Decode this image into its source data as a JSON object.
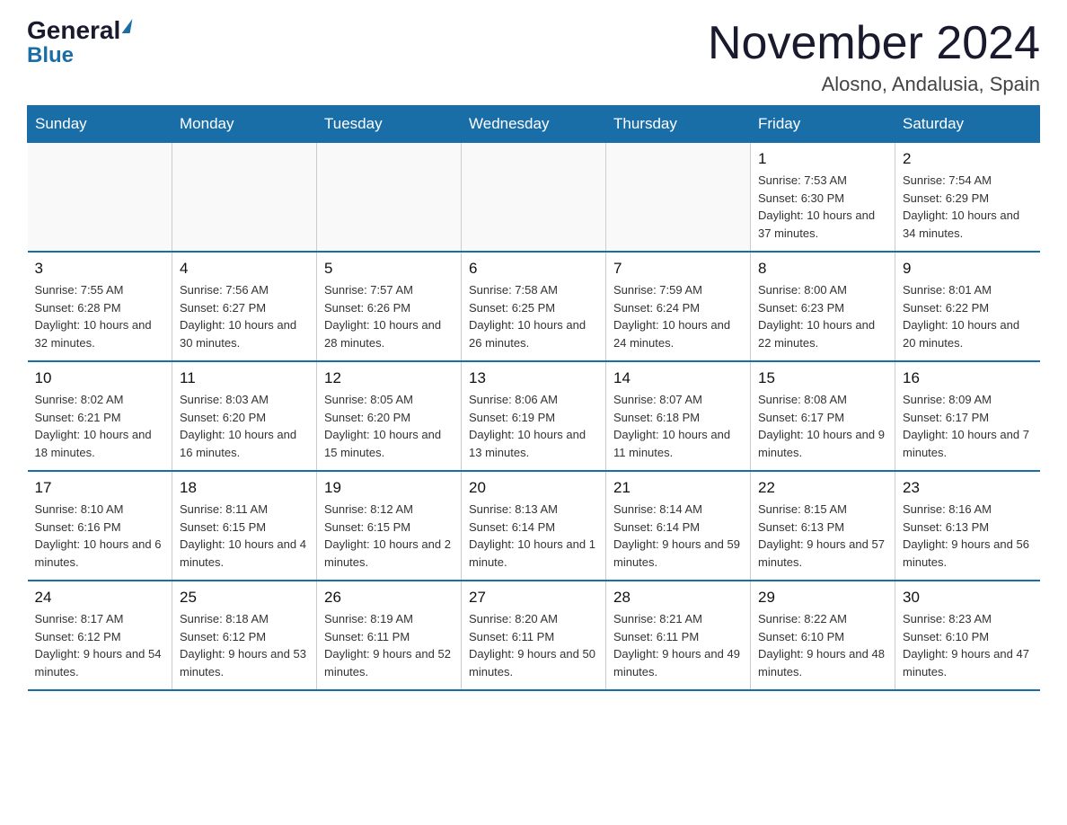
{
  "header": {
    "logo_general": "General",
    "logo_blue": "Blue",
    "month_title": "November 2024",
    "location": "Alosno, Andalusia, Spain"
  },
  "days_of_week": [
    "Sunday",
    "Monday",
    "Tuesday",
    "Wednesday",
    "Thursday",
    "Friday",
    "Saturday"
  ],
  "weeks": [
    [
      {
        "num": "",
        "info": ""
      },
      {
        "num": "",
        "info": ""
      },
      {
        "num": "",
        "info": ""
      },
      {
        "num": "",
        "info": ""
      },
      {
        "num": "",
        "info": ""
      },
      {
        "num": "1",
        "info": "Sunrise: 7:53 AM\nSunset: 6:30 PM\nDaylight: 10 hours and 37 minutes."
      },
      {
        "num": "2",
        "info": "Sunrise: 7:54 AM\nSunset: 6:29 PM\nDaylight: 10 hours and 34 minutes."
      }
    ],
    [
      {
        "num": "3",
        "info": "Sunrise: 7:55 AM\nSunset: 6:28 PM\nDaylight: 10 hours and 32 minutes."
      },
      {
        "num": "4",
        "info": "Sunrise: 7:56 AM\nSunset: 6:27 PM\nDaylight: 10 hours and 30 minutes."
      },
      {
        "num": "5",
        "info": "Sunrise: 7:57 AM\nSunset: 6:26 PM\nDaylight: 10 hours and 28 minutes."
      },
      {
        "num": "6",
        "info": "Sunrise: 7:58 AM\nSunset: 6:25 PM\nDaylight: 10 hours and 26 minutes."
      },
      {
        "num": "7",
        "info": "Sunrise: 7:59 AM\nSunset: 6:24 PM\nDaylight: 10 hours and 24 minutes."
      },
      {
        "num": "8",
        "info": "Sunrise: 8:00 AM\nSunset: 6:23 PM\nDaylight: 10 hours and 22 minutes."
      },
      {
        "num": "9",
        "info": "Sunrise: 8:01 AM\nSunset: 6:22 PM\nDaylight: 10 hours and 20 minutes."
      }
    ],
    [
      {
        "num": "10",
        "info": "Sunrise: 8:02 AM\nSunset: 6:21 PM\nDaylight: 10 hours and 18 minutes."
      },
      {
        "num": "11",
        "info": "Sunrise: 8:03 AM\nSunset: 6:20 PM\nDaylight: 10 hours and 16 minutes."
      },
      {
        "num": "12",
        "info": "Sunrise: 8:05 AM\nSunset: 6:20 PM\nDaylight: 10 hours and 15 minutes."
      },
      {
        "num": "13",
        "info": "Sunrise: 8:06 AM\nSunset: 6:19 PM\nDaylight: 10 hours and 13 minutes."
      },
      {
        "num": "14",
        "info": "Sunrise: 8:07 AM\nSunset: 6:18 PM\nDaylight: 10 hours and 11 minutes."
      },
      {
        "num": "15",
        "info": "Sunrise: 8:08 AM\nSunset: 6:17 PM\nDaylight: 10 hours and 9 minutes."
      },
      {
        "num": "16",
        "info": "Sunrise: 8:09 AM\nSunset: 6:17 PM\nDaylight: 10 hours and 7 minutes."
      }
    ],
    [
      {
        "num": "17",
        "info": "Sunrise: 8:10 AM\nSunset: 6:16 PM\nDaylight: 10 hours and 6 minutes."
      },
      {
        "num": "18",
        "info": "Sunrise: 8:11 AM\nSunset: 6:15 PM\nDaylight: 10 hours and 4 minutes."
      },
      {
        "num": "19",
        "info": "Sunrise: 8:12 AM\nSunset: 6:15 PM\nDaylight: 10 hours and 2 minutes."
      },
      {
        "num": "20",
        "info": "Sunrise: 8:13 AM\nSunset: 6:14 PM\nDaylight: 10 hours and 1 minute."
      },
      {
        "num": "21",
        "info": "Sunrise: 8:14 AM\nSunset: 6:14 PM\nDaylight: 9 hours and 59 minutes."
      },
      {
        "num": "22",
        "info": "Sunrise: 8:15 AM\nSunset: 6:13 PM\nDaylight: 9 hours and 57 minutes."
      },
      {
        "num": "23",
        "info": "Sunrise: 8:16 AM\nSunset: 6:13 PM\nDaylight: 9 hours and 56 minutes."
      }
    ],
    [
      {
        "num": "24",
        "info": "Sunrise: 8:17 AM\nSunset: 6:12 PM\nDaylight: 9 hours and 54 minutes."
      },
      {
        "num": "25",
        "info": "Sunrise: 8:18 AM\nSunset: 6:12 PM\nDaylight: 9 hours and 53 minutes."
      },
      {
        "num": "26",
        "info": "Sunrise: 8:19 AM\nSunset: 6:11 PM\nDaylight: 9 hours and 52 minutes."
      },
      {
        "num": "27",
        "info": "Sunrise: 8:20 AM\nSunset: 6:11 PM\nDaylight: 9 hours and 50 minutes."
      },
      {
        "num": "28",
        "info": "Sunrise: 8:21 AM\nSunset: 6:11 PM\nDaylight: 9 hours and 49 minutes."
      },
      {
        "num": "29",
        "info": "Sunrise: 8:22 AM\nSunset: 6:10 PM\nDaylight: 9 hours and 48 minutes."
      },
      {
        "num": "30",
        "info": "Sunrise: 8:23 AM\nSunset: 6:10 PM\nDaylight: 9 hours and 47 minutes."
      }
    ]
  ]
}
